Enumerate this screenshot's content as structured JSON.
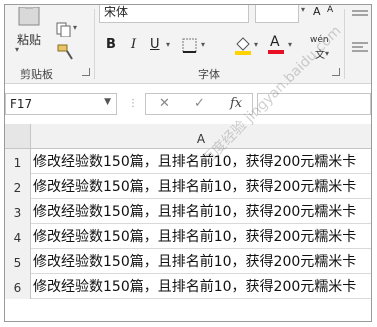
{
  "ribbon": {
    "clipboard": {
      "paste_label": "粘贴",
      "group_label": "剪贴板"
    },
    "font": {
      "font_name": "宋体",
      "group_label": "字体",
      "bold": "B",
      "italic": "I",
      "underline": "U",
      "phonetic_label": "wén",
      "phonetic_sub": "文",
      "font_color_glyph": "A",
      "font_color": "#e81123",
      "fill_color": "#ffd400"
    }
  },
  "formula_bar": {
    "name_box": "F17",
    "cancel_glyph": "✕",
    "enter_glyph": "✓",
    "fx_glyph": "fx",
    "value": ""
  },
  "sheet": {
    "column_header": "A",
    "rows": [
      {
        "num": "1",
        "text": "修改经验数150篇，且排名前10，获得200元糯米卡"
      },
      {
        "num": "2",
        "text": "修改经验数150篇，且排名前10，获得200元糯米卡"
      },
      {
        "num": "3",
        "text": "修改经验数150篇，且排名前10，获得200元糯米卡"
      },
      {
        "num": "4",
        "text": "修改经验数150篇，且排名前10，获得200元糯米卡"
      },
      {
        "num": "5",
        "text": "修改经验数150篇，且排名前10，获得200元糯米卡"
      },
      {
        "num": "6",
        "text": "修改经验数150篇，且排名前10，获得200元糯米卡"
      }
    ]
  },
  "watermark": "百度经验 jingyan.baidu.com"
}
